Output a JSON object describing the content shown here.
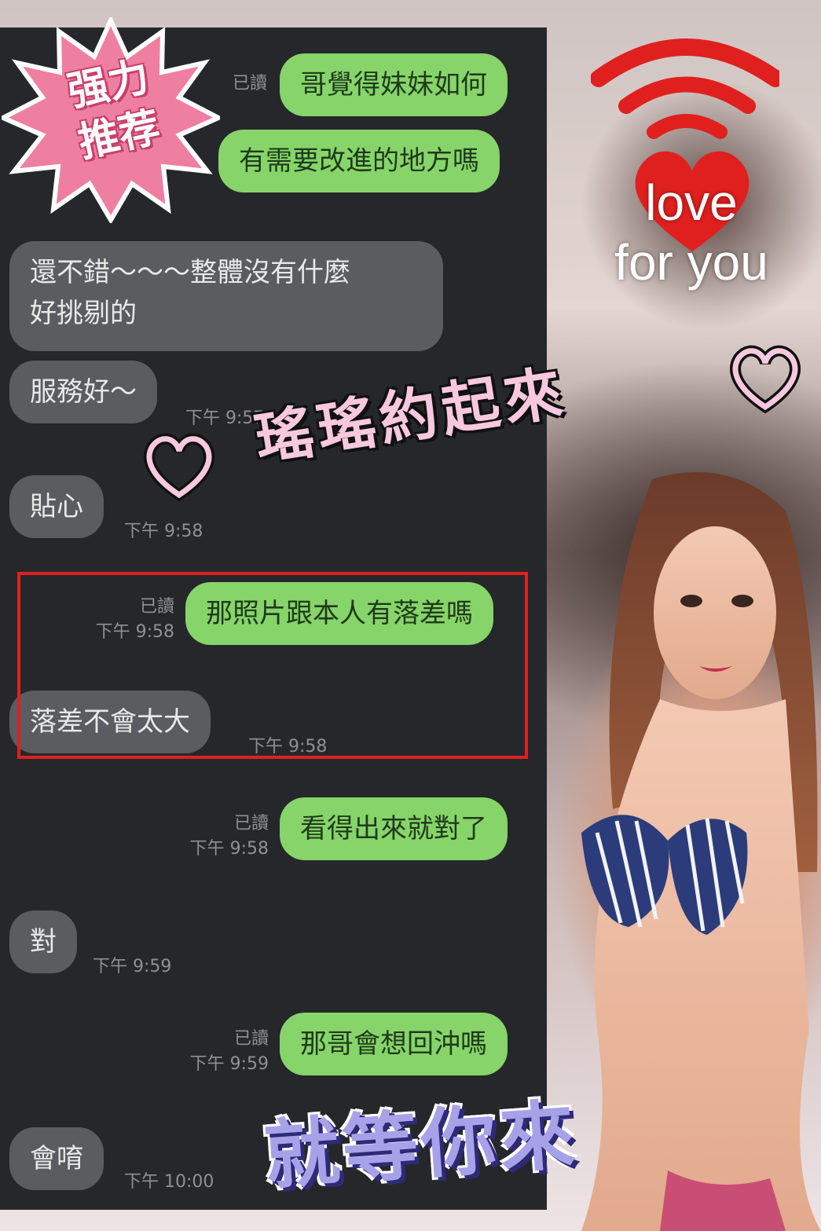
{
  "badge": {
    "line1": "强力",
    "line2": "推荐"
  },
  "chat": {
    "messages": [
      {
        "dir": "out",
        "text": "哥覺得妹妹如何",
        "read": "已讀",
        "time": ""
      },
      {
        "dir": "out",
        "text": "有需要改進的地方嗎",
        "read": "",
        "time": ""
      },
      {
        "dir": "in",
        "text": "還不錯～～～整體沒有什麼",
        "text2": "好挑剔的",
        "time": ""
      },
      {
        "dir": "in",
        "text": "服務好～",
        "time": "下午 9:57"
      },
      {
        "dir": "in",
        "text": "貼心",
        "time": "下午 9:58"
      },
      {
        "dir": "out",
        "text": "那照片跟本人有落差嗎",
        "read": "已讀",
        "time": "下午 9:58"
      },
      {
        "dir": "in",
        "text": "落差不會太大",
        "time": "下午 9:58"
      },
      {
        "dir": "out",
        "text": "看得出來就對了",
        "read": "已讀",
        "time": "下午 9:58"
      },
      {
        "dir": "in",
        "text": "對",
        "time": "下午 9:59"
      },
      {
        "dir": "out",
        "text": "那哥會想回沖嗎",
        "read": "已讀",
        "time": "下午 9:59"
      },
      {
        "dir": "in",
        "text": "會唷",
        "time": "下午 10:00"
      }
    ]
  },
  "love": {
    "line1": "love",
    "line2": "for you"
  },
  "slogan": "瑤瑤約起來",
  "bottom_banner": "就等你來",
  "colors": {
    "chat_bg": "#26272a",
    "bubble_out": "#86d46a",
    "bubble_in": "#5b5c60",
    "highlight": "#e02020",
    "badge": "#ee7fa0",
    "heart": "#e0201f",
    "slogan": "#f7c8de"
  }
}
